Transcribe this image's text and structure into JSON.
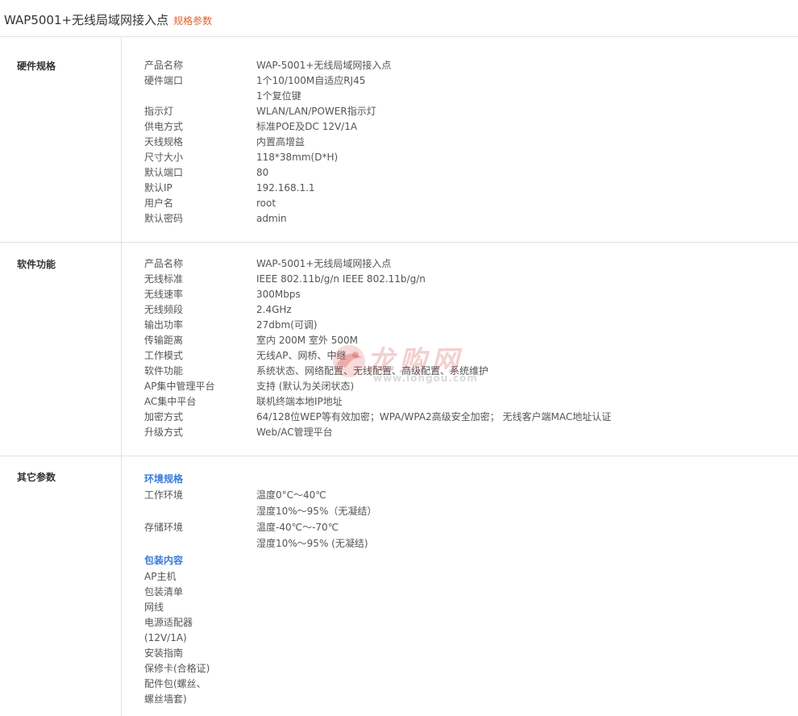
{
  "header": {
    "title": "WAP5001+无线局域网接入点",
    "subtitle": "规格参数"
  },
  "sections": [
    {
      "label": "硬件规格",
      "rows": [
        {
          "k": "产品名称",
          "v": "WAP-5001+无线局域网接入点"
        },
        {
          "k": "硬件端口",
          "v": "1个10/100M自适应RJ45"
        },
        {
          "k": "",
          "v": "1个复位键"
        },
        {
          "k": "指示灯",
          "v": "WLAN/LAN/POWER指示灯"
        },
        {
          "k": "供电方式",
          "v": "标准POE及DC 12V/1A"
        },
        {
          "k": "天线规格",
          "v": "内置高增益"
        },
        {
          "k": "尺寸大小",
          "v": "118*38mm(D*H)"
        },
        {
          "k": "默认端口",
          "v": "80"
        },
        {
          "k": "默认IP",
          "v": "192.168.1.1"
        },
        {
          "k": "用户名",
          "v": "root"
        },
        {
          "k": "默认密码",
          "v": "admin"
        }
      ]
    },
    {
      "label": "软件功能",
      "rows": [
        {
          "k": "产品名称",
          "v": "WAP-5001+无线局域网接入点"
        },
        {
          "k": "无线标准",
          "v": "IEEE 802.11b/g/n   IEEE 802.11b/g/n"
        },
        {
          "k": "无线速率",
          "v": "300Mbps"
        },
        {
          "k": "无线频段",
          "v": "2.4GHz"
        },
        {
          "k": "输出功率",
          "v": "27dbm(可调)"
        },
        {
          "k": "传输距离",
          "v": "室内 200M  室外 500M"
        },
        {
          "k": "工作模式",
          "v": "无线AP、网桥、中继"
        },
        {
          "k": "软件功能",
          "v": "系统状态、网络配置、无线配置、高级配置、系统维护"
        },
        {
          "k": "AP集中管理平台",
          "v": "支持 (默认为关闭状态)"
        },
        {
          "k": "AC集中平台",
          "v": "联机终端本地IP地址"
        },
        {
          "k": "加密方式",
          "v": "64/128位WEP等有效加密；WPA/WPA2高级安全加密； 无线客户端MAC地址认证"
        },
        {
          "k": "升级方式",
          "v": "Web/AC管理平台"
        }
      ]
    },
    {
      "label": "其它参数",
      "env_heading": "环境规格",
      "env_rows": [
        {
          "k": "工作环境",
          "v": "温度0°C～40℃"
        },
        {
          "k": "",
          "v": "湿度10%～95%（无凝结）"
        },
        {
          "k": "存储环境",
          "v": "温度-40℃～-70℃"
        },
        {
          "k": "",
          "v": "湿度10%～95% (无凝结)"
        }
      ],
      "pkg_heading": "包装内容",
      "pkg_items": [
        "AP主机",
        "包装清单",
        "网线",
        "电源适配器",
        "(12V/1A)",
        "安装指南",
        "保修卡(合格证)",
        "配件包(螺丝、",
        "螺丝墙套)"
      ]
    }
  ],
  "watermark": {
    "text": "龙购网",
    "url": "www.longou.com"
  }
}
